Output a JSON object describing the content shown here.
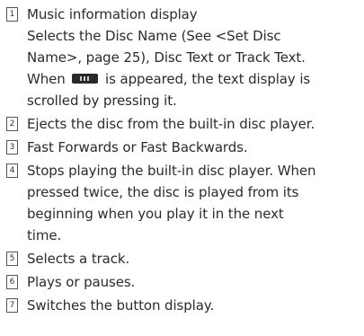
{
  "items": [
    {
      "number": "1",
      "lines": [
        "Music information display",
        "Selects the Disc Name (See <Set Disc",
        "Name>, page 25), Disc Text or Track Text.",
        "is appeared, the text display is",
        "scrolled by pressing it."
      ],
      "line4_prefix": "When",
      "icon": "scroll-button-icon"
    },
    {
      "number": "2",
      "lines": [
        "Ejects the disc from the built-in disc player."
      ]
    },
    {
      "number": "3",
      "lines": [
        "Fast Forwards or Fast Backwards."
      ]
    },
    {
      "number": "4",
      "lines": [
        "Stops playing the built-in disc player. When",
        "pressed twice, the disc is played from its",
        "beginning when you play it in the next",
        "time."
      ]
    },
    {
      "number": "5",
      "lines": [
        "Selects a track."
      ]
    },
    {
      "number": "6",
      "lines": [
        "Plays or pauses."
      ]
    },
    {
      "number": "7",
      "lines": [
        "Switches the button display."
      ]
    }
  ]
}
